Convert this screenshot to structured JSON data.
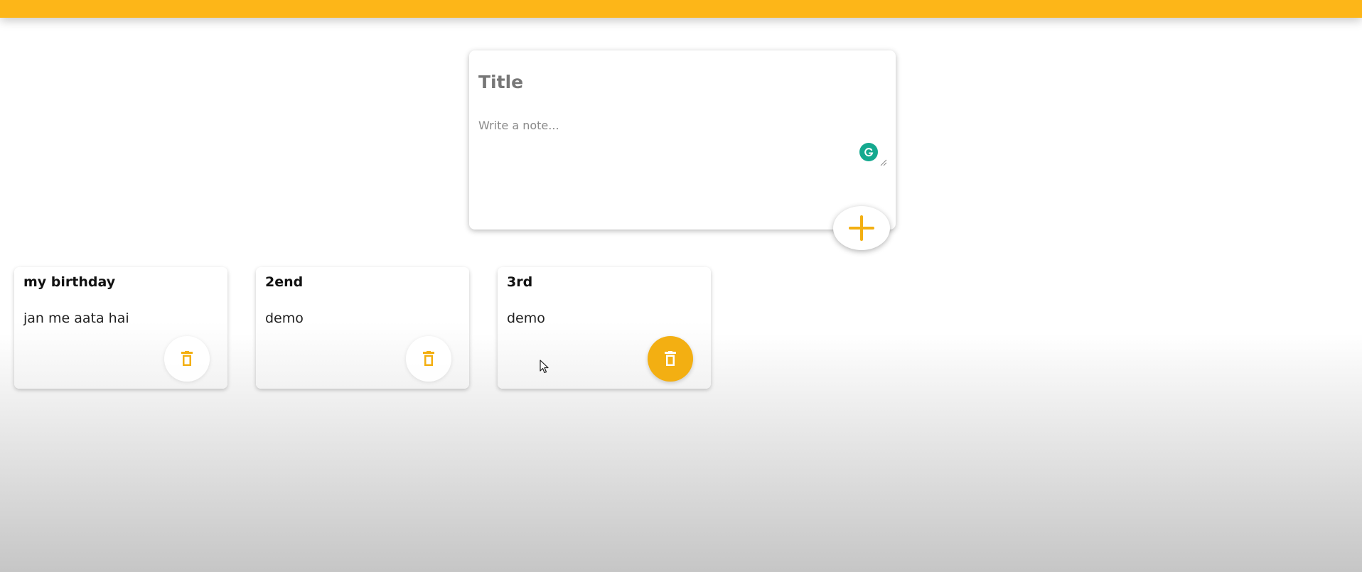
{
  "colors": {
    "accent": "#fdb618",
    "delete_active": "#f3af12",
    "grammarly": "#14a98f"
  },
  "compose": {
    "title_placeholder": "Title",
    "body_placeholder": "Write a note...",
    "add_icon": "plus-icon",
    "assistant_icon": "grammarly-icon"
  },
  "notes": [
    {
      "title": "my birthday",
      "content": "jan me aata hai",
      "delete_icon": "trash-icon"
    },
    {
      "title": "2end",
      "content": "demo",
      "delete_icon": "trash-icon"
    },
    {
      "title": "3rd",
      "content": "demo",
      "delete_icon": "trash-icon"
    }
  ]
}
